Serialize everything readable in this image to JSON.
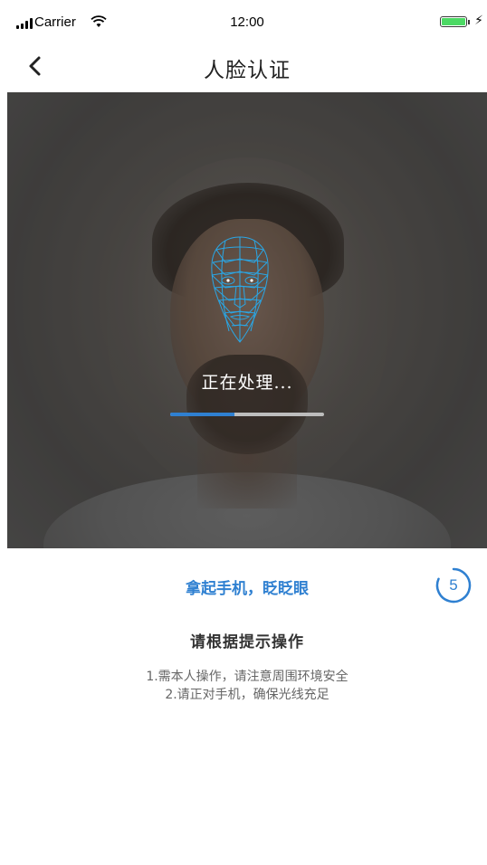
{
  "status_bar": {
    "carrier": "Carrier",
    "time": "12:00"
  },
  "nav": {
    "title": "人脸认证"
  },
  "camera": {
    "processing_text": "正在处理...",
    "progress": 0.42
  },
  "instruction": {
    "action_text": "拿起手机，眨眨眼",
    "countdown": "5",
    "subtitle": "请根据提示操作",
    "tips": [
      "1.需本人操作，请注意周围环境安全",
      "2.请正对手机，确保光线充足"
    ]
  },
  "colors": {
    "accent": "#2f80d1",
    "mesh": "#2aa7e6"
  }
}
